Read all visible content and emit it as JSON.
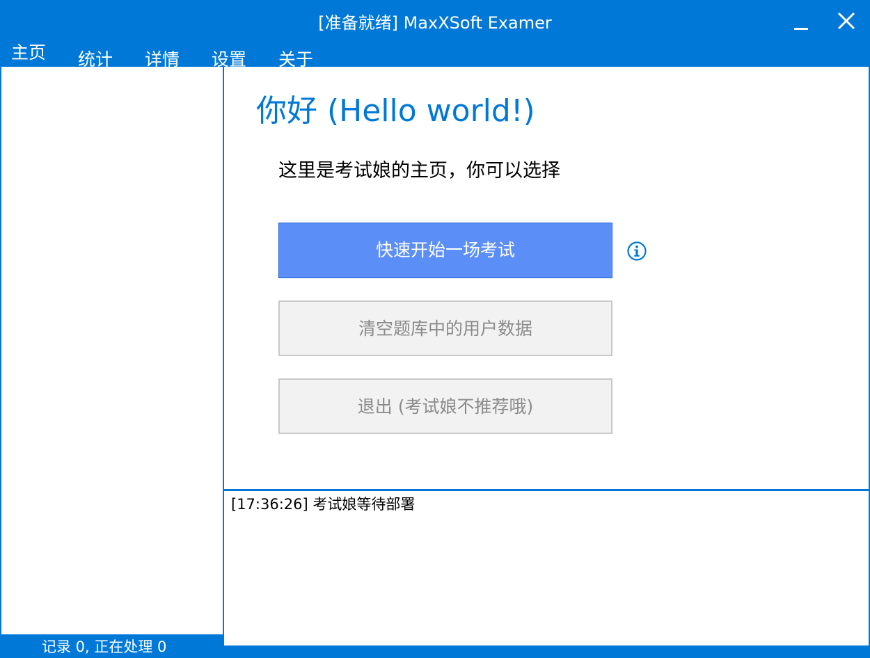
{
  "window": {
    "title": "[准备就绪] MaxXSoft Examer"
  },
  "menu": {
    "items": [
      {
        "label": "主页"
      },
      {
        "label": "统计"
      },
      {
        "label": "详情"
      },
      {
        "label": "设置"
      },
      {
        "label": "关于"
      }
    ]
  },
  "home": {
    "greeting": "你好 (Hello world!)",
    "intro": "这里是考试娘的主页，你可以选择",
    "buttons": {
      "quick_start": "快速开始一场考试",
      "clear_data": "清空题库中的用户数据",
      "exit": "退出 (考试娘不推荐哦)"
    },
    "info_icon": "info-icon"
  },
  "log": {
    "lines": [
      "[17:36:26] 考试娘等待部署"
    ]
  },
  "status": {
    "text": "记录 0, 正在处理 0"
  },
  "colors": {
    "accent": "#0078d7",
    "primary_button": "#5c8ef7",
    "disabled_button": "#f2f2f2",
    "disabled_text": "#8a8a8a"
  }
}
